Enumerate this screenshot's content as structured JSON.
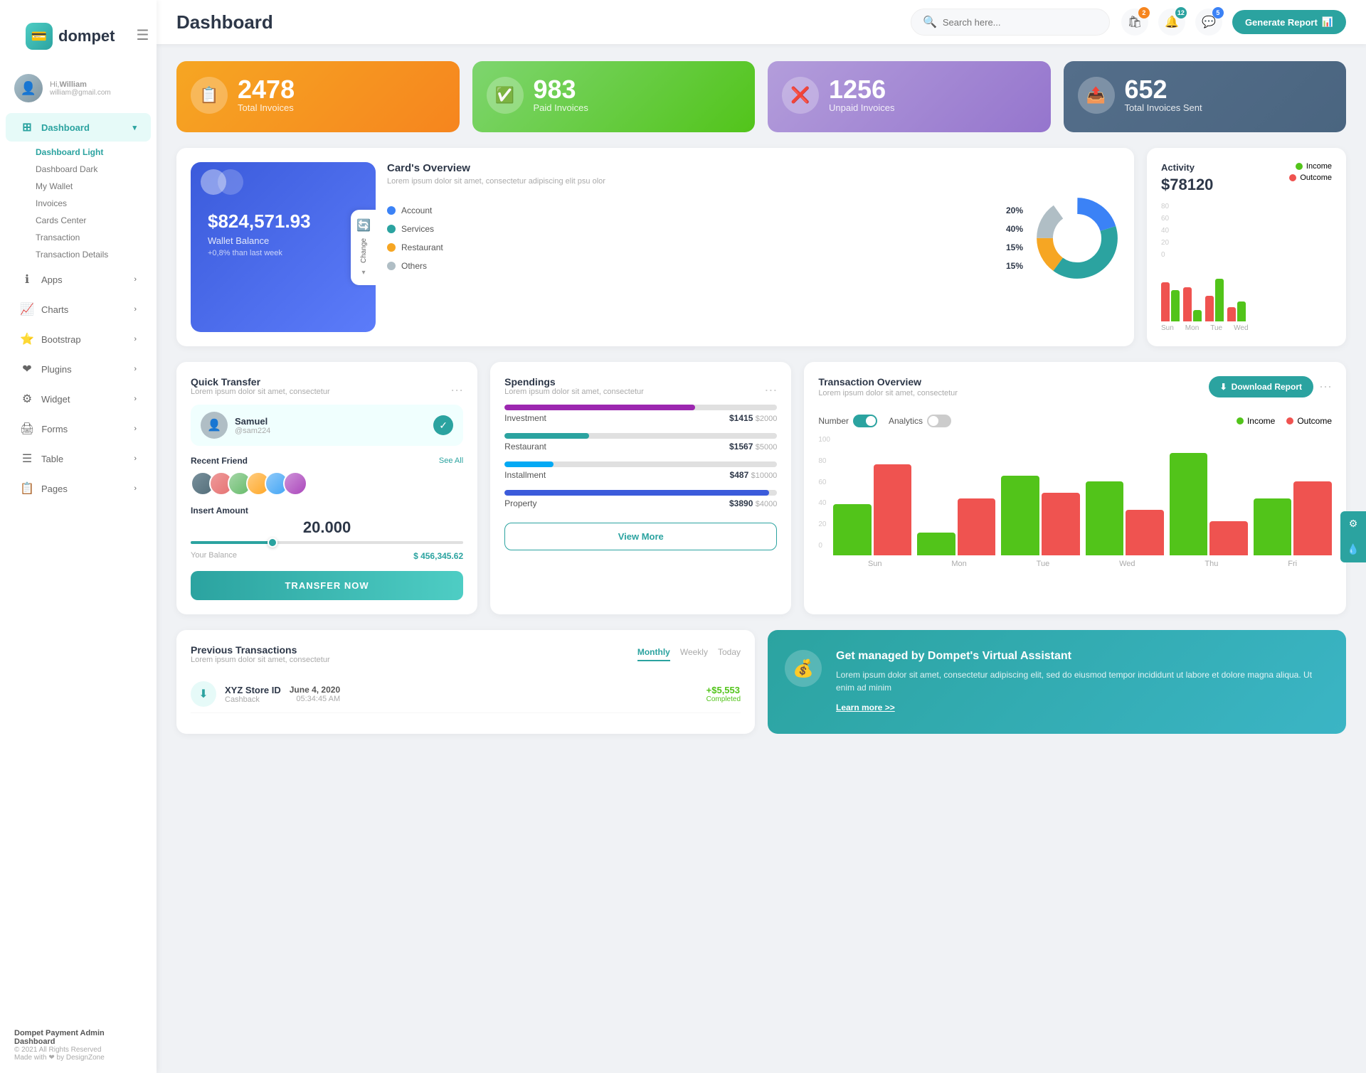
{
  "sidebar": {
    "logo": "dompet",
    "logo_icon": "💳",
    "hamburger": "☰",
    "user": {
      "greeting": "Hi,",
      "name": "William",
      "email": "william@gmail.com"
    },
    "nav": [
      {
        "id": "dashboard",
        "label": "Dashboard",
        "icon": "⊞",
        "active": true,
        "hasArrow": true
      },
      {
        "id": "apps",
        "label": "Apps",
        "icon": "ℹ",
        "hasArrow": true
      },
      {
        "id": "charts",
        "label": "Charts",
        "icon": "📈",
        "hasArrow": true
      },
      {
        "id": "bootstrap",
        "label": "Bootstrap",
        "icon": "⭐",
        "hasArrow": true
      },
      {
        "id": "plugins",
        "label": "Plugins",
        "icon": "❤",
        "hasArrow": true
      },
      {
        "id": "widget",
        "label": "Widget",
        "icon": "⚙",
        "hasArrow": true
      },
      {
        "id": "forms",
        "label": "Forms",
        "icon": "🖨",
        "hasArrow": true
      },
      {
        "id": "table",
        "label": "Table",
        "icon": "☰",
        "hasArrow": true
      },
      {
        "id": "pages",
        "label": "Pages",
        "icon": "📋",
        "hasArrow": true
      }
    ],
    "submenu": [
      "Dashboard Light",
      "Dashboard Dark",
      "My Wallet",
      "Invoices",
      "Cards Center",
      "Transaction",
      "Transaction Details"
    ],
    "footer": {
      "app_name": "Dompet Payment Admin Dashboard",
      "copyright": "© 2021 All Rights Reserved",
      "made_with": "Made with ❤ by DesignZone"
    }
  },
  "header": {
    "title": "Dashboard",
    "search_placeholder": "Search here...",
    "icons": {
      "shopping_badge": "2",
      "bell_badge": "12",
      "chat_badge": "5"
    },
    "generate_btn": "Generate Report"
  },
  "stats": [
    {
      "id": "total-invoices",
      "number": "2478",
      "label": "Total Invoices",
      "color": "orange",
      "icon": "📋"
    },
    {
      "id": "paid-invoices",
      "number": "983",
      "label": "Paid Invoices",
      "color": "green",
      "icon": "✅"
    },
    {
      "id": "unpaid-invoices",
      "number": "1256",
      "label": "Unpaid Invoices",
      "color": "purple",
      "icon": "❌"
    },
    {
      "id": "total-sent",
      "number": "652",
      "label": "Total Invoices Sent",
      "color": "teal",
      "icon": "📤"
    }
  ],
  "cards_overview": {
    "wallet": {
      "amount": "$824,571.93",
      "label": "Wallet Balance",
      "change": "+0,8% than last week",
      "change_btn": "Change"
    },
    "overview": {
      "title": "Card's Overview",
      "subtitle": "Lorem ipsum dolor sit amet, consectetur adipiscing elit psu olor",
      "legend": [
        {
          "name": "Account",
          "pct": "20%",
          "color": "#3b82f6"
        },
        {
          "name": "Services",
          "pct": "40%",
          "color": "#2ba3a0"
        },
        {
          "name": "Restaurant",
          "pct": "15%",
          "color": "#f6a623"
        },
        {
          "name": "Others",
          "pct": "15%",
          "color": "#b0bec5"
        }
      ]
    }
  },
  "activity": {
    "title": "Activity",
    "amount": "$78120",
    "legend": [
      {
        "name": "Income",
        "color": "#52c41a"
      },
      {
        "name": "Outcome",
        "color": "#ef5350"
      }
    ],
    "bars": [
      {
        "day": "Sun",
        "income": 55,
        "outcome": 70
      },
      {
        "day": "Mon",
        "income": 20,
        "outcome": 60
      },
      {
        "day": "Tue",
        "income": 75,
        "outcome": 45
      },
      {
        "day": "Wed",
        "income": 35,
        "outcome": 25
      }
    ]
  },
  "quick_transfer": {
    "title": "Quick Transfer",
    "subtitle": "Lorem ipsum dolor sit amet, consectetur",
    "contact": {
      "name": "Samuel",
      "handle": "@sam224",
      "color": "#78909c"
    },
    "recent_label": "Recent Friend",
    "see_all": "See All",
    "insert_label": "Insert Amount",
    "amount": "20.000",
    "balance_label": "Your Balance",
    "balance": "$ 456,345.62",
    "transfer_btn": "TRANSFER NOW"
  },
  "spendings": {
    "title": "Spendings",
    "subtitle": "Lorem ipsum dolor sit amet, consectetur",
    "items": [
      {
        "name": "Investment",
        "amount": "$1415",
        "max": "$2000",
        "pct": 70,
        "color": "#9c27b0"
      },
      {
        "name": "Restaurant",
        "amount": "$1567",
        "max": "$5000",
        "pct": 31,
        "color": "#2ba3a0"
      },
      {
        "name": "Installment",
        "amount": "$487",
        "max": "$10000",
        "pct": 18,
        "color": "#03a9f4"
      },
      {
        "name": "Property",
        "amount": "$3890",
        "max": "$4000",
        "pct": 97,
        "color": "#3b5bdb"
      }
    ],
    "view_more": "View More"
  },
  "transaction_overview": {
    "title": "Transaction Overview",
    "subtitle": "Lorem ipsum dolor sit amet, consectetur",
    "download_btn": "Download Report",
    "toggles": [
      {
        "label": "Number",
        "active": true
      },
      {
        "label": "Analytics",
        "active": false
      }
    ],
    "legend": [
      {
        "name": "Income",
        "color": "#52c41a"
      },
      {
        "name": "Outcome",
        "color": "#ef5350"
      }
    ],
    "bars": [
      {
        "day": "Sun",
        "income": 45,
        "outcome": 80
      },
      {
        "day": "Mon",
        "income": 20,
        "outcome": 50
      },
      {
        "day": "Tue",
        "income": 70,
        "outcome": 55
      },
      {
        "day": "Wed",
        "income": 65,
        "outcome": 40
      },
      {
        "day": "Thu",
        "income": 90,
        "outcome": 30
      },
      {
        "day": "Fri",
        "income": 50,
        "outcome": 65
      }
    ],
    "y_labels": [
      "100",
      "80",
      "60",
      "40",
      "20",
      "0"
    ]
  },
  "previous_transactions": {
    "title": "Previous Transactions",
    "subtitle": "Lorem ipsum dolor sit amet, consectetur",
    "tabs": [
      "Monthly",
      "Weekly",
      "Today"
    ],
    "active_tab": "Monthly",
    "items": [
      {
        "name": "XYZ Store ID",
        "type": "Cashback",
        "date_label": "June 4, 2020",
        "time": "05:34:45 AM",
        "amount": "+$5,553",
        "status": "Completed",
        "icon": "⬇",
        "icon_color": "#2ba3a0"
      }
    ]
  },
  "virtual_assistant": {
    "title": "Get managed by Dompet's Virtual Assistant",
    "text": "Lorem ipsum dolor sit amet, consectetur adipiscing elit, sed do eiusmod tempor incididunt ut labore et dolore magna aliqua. Ut enim ad minim",
    "link": "Learn more >>",
    "icon": "💰"
  }
}
